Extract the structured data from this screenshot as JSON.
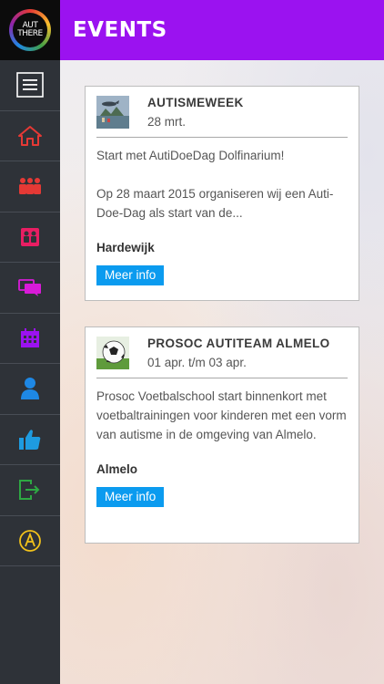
{
  "header": {
    "title": "EVENTS"
  },
  "logo": {
    "line1": "AUT",
    "line2": "THERE"
  },
  "sidebar": {
    "items": [
      {
        "icon": "menu-icon",
        "color": "#ffffff"
      },
      {
        "icon": "home-icon",
        "color": "#e53935"
      },
      {
        "icon": "group-icon",
        "color": "#e53935"
      },
      {
        "icon": "contacts-icon",
        "color": "#e91e63"
      },
      {
        "icon": "chat-icon",
        "color": "#d81bd8"
      },
      {
        "icon": "calendar-icon",
        "color": "#9b12f0"
      },
      {
        "icon": "user-icon",
        "color": "#1e88e5"
      },
      {
        "icon": "thumbs-up-icon",
        "color": "#1e9be0"
      },
      {
        "icon": "logout-icon",
        "color": "#2ea843"
      },
      {
        "icon": "autism-a-icon",
        "color": "#f2c21b"
      }
    ]
  },
  "events": [
    {
      "title": "AUTISMEWEEK",
      "date": "28 mrt.",
      "description": "Start met AutiDoeDag Dolfinarium!\n\nOp 28 maart 2015 organiseren wij een Auti-Doe-Dag als start van de...",
      "location": "Hardewijk",
      "button": "Meer info"
    },
    {
      "title": "PROSOC AUTITEAM ALMELO",
      "date": "01 apr. t/m 03 apr.",
      "description": "Prosoc Voetbalschool start binnenkort met voetbaltrainingen voor kinderen met een vorm van autisme in de omgeving van Almelo.",
      "location": "Almelo",
      "button": "Meer info"
    }
  ],
  "colors": {
    "header": "#9b12f0",
    "sidebar": "#2e3238",
    "button": "#0b9bef"
  }
}
